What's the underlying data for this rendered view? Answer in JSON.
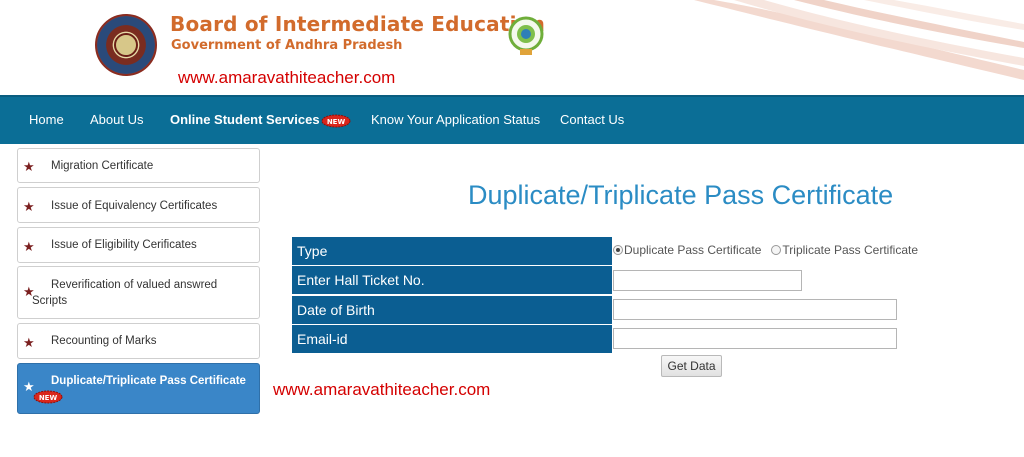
{
  "header": {
    "title": "Board of Intermediate Education",
    "subtitle": "Government of Andhra Pradesh",
    "watermark": "www.amaravathiteacher.com"
  },
  "nav": {
    "items": [
      {
        "label": "Home"
      },
      {
        "label": "About Us"
      },
      {
        "label": "Online Student Services",
        "badge": "NEW"
      },
      {
        "label": "Know Your Application Status"
      },
      {
        "label": "Contact Us"
      }
    ]
  },
  "sidebar": {
    "items": [
      {
        "label": "Migration Certificate"
      },
      {
        "label": "Issue of Equivalency Certificates"
      },
      {
        "label": "Issue of Eligibility Cerificates"
      },
      {
        "label": "Reverification of valued answred Scripts"
      },
      {
        "label": "Recounting of Marks"
      },
      {
        "label": "Duplicate/Triplicate Pass Certificate",
        "badge": "NEW",
        "active": true
      }
    ]
  },
  "main": {
    "title": "Duplicate/Triplicate Pass Certificate",
    "form": {
      "type_label": "Type",
      "type_options": [
        "Duplicate Pass Certificate",
        "Triplicate Pass Certificate"
      ],
      "type_selected": "Duplicate Pass Certificate",
      "hall_ticket_label": "Enter Hall Ticket No.",
      "hall_ticket_value": "",
      "dob_label": "Date of Birth",
      "dob_value": "",
      "email_label": "Email-id",
      "email_value": "",
      "submit_label": "Get Data"
    }
  },
  "colors": {
    "navbar": "#0b6e96",
    "form_label_bg": "#0b5e92",
    "title": "#2b8cc4",
    "brand": "#d26b2c",
    "watermark": "#d40000",
    "active_sidebar": "#3a86c8"
  }
}
